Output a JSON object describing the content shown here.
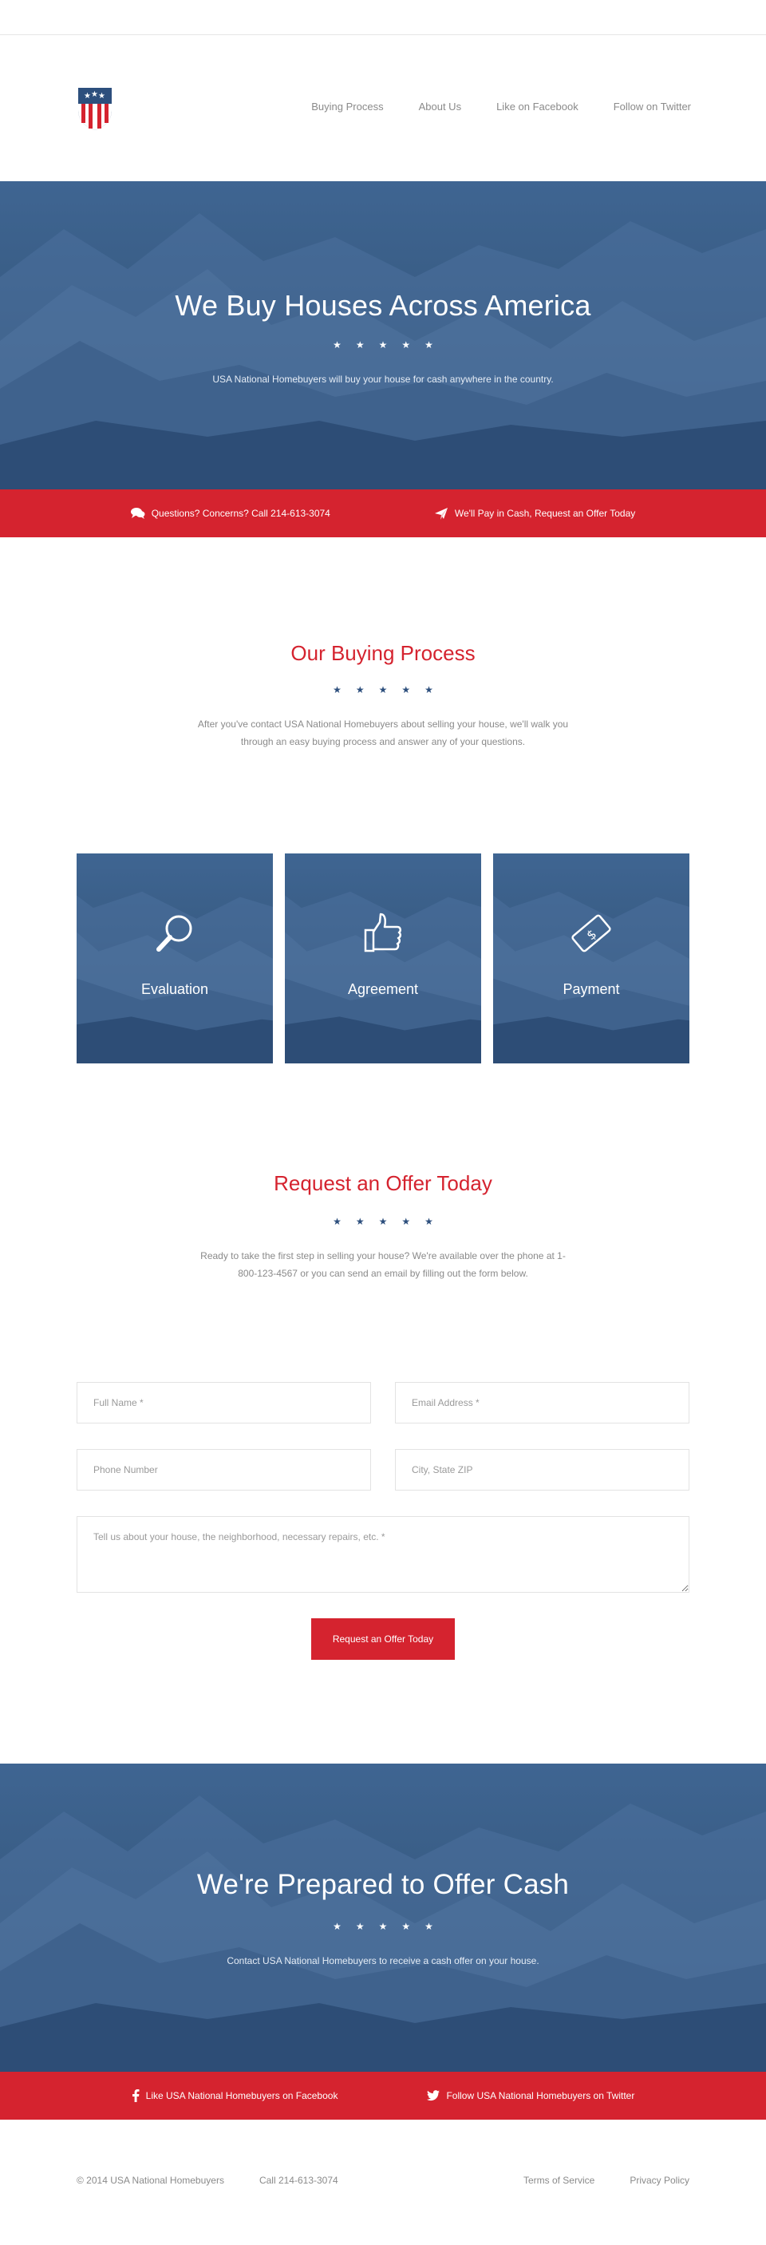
{
  "nav": {
    "items": [
      "Buying Process",
      "About Us",
      "Like on Facebook",
      "Follow on Twitter"
    ]
  },
  "hero": {
    "title": "We Buy Houses Across America",
    "subtitle": "USA National Homebuyers will buy your house for cash anywhere in the country."
  },
  "stars": [
    "★",
    "★",
    "★",
    "★",
    "★"
  ],
  "contact_bar": {
    "left": "Questions? Concerns? Call 214-613-3074",
    "right": "We'll Pay in Cash, Request an Offer Today",
    "left_icon": "chat-bubbles-icon",
    "right_icon": "paper-plane-icon"
  },
  "buying": {
    "title": "Our Buying Process",
    "text": "After you've contact USA National Homebuyers about selling your house, we'll walk you through an easy buying process and answer any of your questions."
  },
  "steps": [
    {
      "label": "Evaluation",
      "icon": "magnifier-icon"
    },
    {
      "label": "Agreement",
      "icon": "thumbs-up-icon"
    },
    {
      "label": "Payment",
      "icon": "money-bill-icon"
    }
  ],
  "request": {
    "title": "Request an Offer Today",
    "text": "Ready to take the first step in selling your house? We're available over the phone at 1-800-123-4567 or you can send an email by filling out the form below."
  },
  "form": {
    "full_name_placeholder": "Full Name *",
    "email_placeholder": "Email Address *",
    "phone_placeholder": "Phone Number",
    "city_placeholder": "City, State ZIP",
    "message_placeholder": "Tell us about your house, the neighborhood, necessary repairs, etc. *",
    "submit_label": "Request an Offer Today"
  },
  "cta": {
    "title": "We're Prepared to Offer Cash",
    "subtitle": "Contact USA National Homebuyers to receive a cash offer on your house."
  },
  "social_bar": {
    "facebook": "Like USA National Homebuyers on Facebook",
    "twitter": "Follow USA National Homebuyers on Twitter"
  },
  "footer": {
    "copyright": "© 2014 USA National Homebuyers",
    "phone": "Call 214-613-3074",
    "terms": "Terms of Service",
    "privacy": "Privacy Policy"
  },
  "colors": {
    "accent_red": "#d5232f",
    "brand_blue": "#2d4f7d",
    "text_gray": "#8a8a8a"
  }
}
